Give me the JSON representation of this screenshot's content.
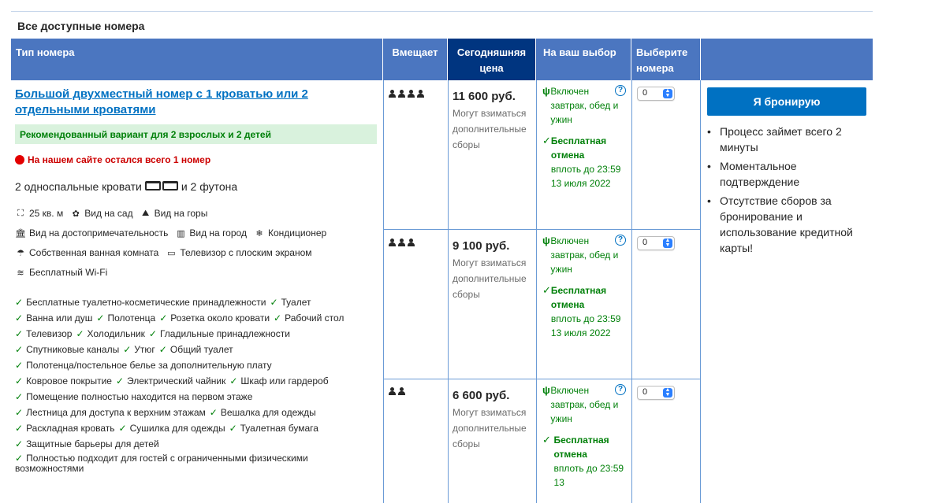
{
  "section_title": "Все доступные номера",
  "headers": {
    "room_type": "Тип номера",
    "sleeps": "Вмещает",
    "todays_price": "Сегодняшняя цена",
    "your_choices": "На ваш выбор",
    "select_rooms": "Выберите номера"
  },
  "room": {
    "name": "Большой двухместный номер с 1 кроватью или 2 отдельными кроватями",
    "recommended": "Рекомендованный вариант для 2 взрослых и 2 детей",
    "scarcity": "На нашем сайте остался всего 1 номер",
    "beds_part1": "2 односпальные кровати",
    "beds_part2": "и 2 футона",
    "facilities": {
      "size": "25 кв. м",
      "garden_view": "Вид на сад",
      "mountain_view": "Вид на горы",
      "landmark_view": "Вид на достопримечательность",
      "city_view": "Вид на город",
      "ac": "Кондиционер",
      "bathroom": "Собственная ванная комната",
      "tv": "Телевизор с плоским экраном",
      "wifi": "Бесплатный Wi-Fi"
    },
    "amenities": [
      [
        "Бесплатные туалетно-косметические принадлежности",
        "Туалет"
      ],
      [
        "Ванна или душ",
        "Полотенца",
        "Розетка около кровати",
        "Рабочий стол"
      ],
      [
        "Телевизор",
        "Холодильник",
        "Гладильные принадлежности"
      ],
      [
        "Спутниковые каналы",
        "Утюг",
        "Общий туалет"
      ],
      [
        "Полотенца/постельное белье за дополнительную плату"
      ],
      [
        "Ковровое покрытие",
        "Электрический чайник",
        "Шкаф или гардероб"
      ],
      [
        "Помещение полностью находится на первом этаже"
      ],
      [
        "Лестница для доступа к верхним этажам",
        "Вешалка для одежды"
      ],
      [
        "Раскладная кровать",
        "Сушилка для одежды",
        "Туалетная бумага"
      ],
      [
        "Защитные барьеры для детей"
      ],
      [
        "Полностью подходит для гостей с ограниченными физическими"
      ],
      [
        "возможностями"
      ]
    ]
  },
  "options": [
    {
      "persons": 4,
      "price": "11 600 руб.",
      "price_note": "Могут взиматься дополнительные сборы",
      "meal": "Включен завтрак, обед и ужин",
      "cancel_bold": "Бесплатная отмена",
      "cancel_until": "вплоть до 23:59 13 июля 2022",
      "qty": "0"
    },
    {
      "persons": 3,
      "price": "9 100 руб.",
      "price_note": "Могут взиматься дополнительные сборы",
      "meal": "Включен завтрак, обед и ужин",
      "cancel_bold": "Бесплатная отмена",
      "cancel_until": "вплоть до 23:59 13 июля 2022",
      "qty": "0"
    },
    {
      "persons": 2,
      "price": "6 600 руб.",
      "price_note": "Могут взиматься дополнительные сборы",
      "meal": "Включен завтрак, обед и ужин",
      "cancel_bold": "Бесплатная отмена",
      "cancel_until": "вплоть до 23:59 13",
      "qty": "0"
    }
  ],
  "book_button": "Я бронирую",
  "benefits": [
    "Процесс займет всего 2 минуты",
    "Моментальное подтверждение",
    "Отсутствие сборов за бронирование и использование кредитной карты!"
  ],
  "colors": {
    "header_bg": "#4b76c0",
    "header_price_bg": "#003580",
    "link": "#0071c2",
    "green": "#008009",
    "red": "#cc0000"
  }
}
